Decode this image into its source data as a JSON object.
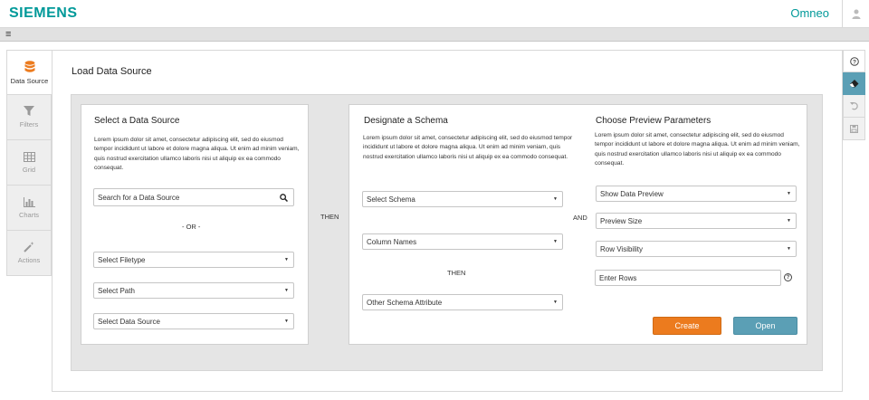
{
  "header": {
    "brand": "SIEMENS",
    "app_name": "Omneo",
    "user_icon": "user-icon",
    "menu_icon": "hamburger-icon",
    "menu_glyph": "≡"
  },
  "left_nav": {
    "items": [
      {
        "label": "Data Source",
        "icon": "database-icon",
        "active": true
      },
      {
        "label": "Filters",
        "icon": "funnel-icon",
        "active": false
      },
      {
        "label": "Grid",
        "icon": "grid-icon",
        "active": false
      },
      {
        "label": "Charts",
        "icon": "bar-chart-icon",
        "active": false
      },
      {
        "label": "Actions",
        "icon": "magic-wand-icon",
        "active": false
      }
    ]
  },
  "right_toolbar": {
    "items": [
      {
        "icon": "help-icon",
        "active": false
      },
      {
        "icon": "eraser-icon",
        "active": true
      },
      {
        "icon": "undo-icon",
        "active": false
      },
      {
        "icon": "save-icon",
        "active": false
      }
    ]
  },
  "page": {
    "title": "Load Data Source"
  },
  "data_source": {
    "title": "Select a Data Source",
    "description": "Lorem ipsum dolor sit amet, consectetur adipiscing elit, sed do eiusmod tempor incididunt ut labore et dolore magna aliqua. Ut enim ad minim veniam, quis nostrud exercitation ullamco laboris nisi ut aliquip ex ea commodo consequat.",
    "search_placeholder": "Search for a Data Source",
    "or_label": "- OR -",
    "select_filetype": "Select Filetype",
    "select_path": "Select Path",
    "select_data_source": "Select Data Source"
  },
  "then_label": "THEN",
  "schema": {
    "title": "Designate a Schema",
    "description": "Lorem ipsum dolor sit amet, consectetur adipiscing elit, sed do eiusmod tempor incididunt ut labore et dolore magna aliqua. Ut enim ad minim veniam, quis nostrud exercitation ullamco laboris nisi ut aliquip ex ea commodo consequat.",
    "select_schema": "Select Schema",
    "column_names": "Column Names",
    "then_label": "THEN",
    "other_attribute": "Other Schema Attribute"
  },
  "and_label": "AND",
  "preview": {
    "title": "Choose Preview Parameters",
    "description": "Lorem ipsum dolor sit amet, consectetur adipiscing elit, sed do eiusmod tempor incididunt ut labore et dolore magna aliqua. Ut enim ad minim veniam, quis nostrud exercitation ullamco laboris nisi ut aliquip ex ea commodo consequat.",
    "show_data_preview": "Show Data Preview",
    "preview_size": "Preview Size",
    "row_visibility": "Row Visibility",
    "enter_rows_placeholder": "Enter Rows",
    "help_glyph": "?"
  },
  "actions": {
    "create_label": "Create",
    "open_label": "Open"
  },
  "colors": {
    "brand": "#009999",
    "create": "#ec7b1e",
    "open": "#5b9fb5"
  }
}
